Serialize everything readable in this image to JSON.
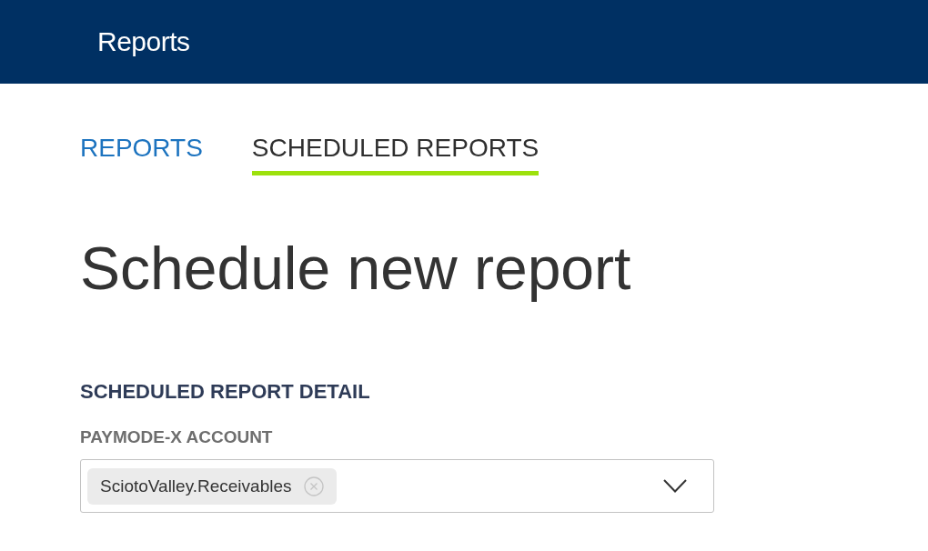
{
  "header": {
    "title": "Reports"
  },
  "tabs": [
    {
      "label": "REPORTS",
      "selected": false
    },
    {
      "label": "SCHEDULED REPORTS",
      "selected": true
    }
  ],
  "page_title": "Schedule new report",
  "section": {
    "title": "SCHEDULED REPORT DETAIL",
    "fields": [
      {
        "kind": "multiselect",
        "label": "PAYMODE-X ACCOUNT",
        "chips": [
          {
            "label": "SciotoValley.Receivables"
          }
        ]
      }
    ]
  }
}
